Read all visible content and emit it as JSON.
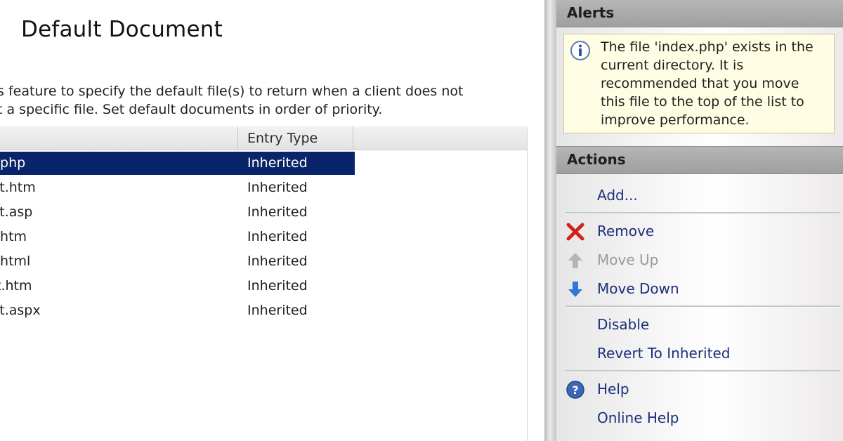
{
  "main": {
    "title": "Default Document",
    "description": [
      "s feature to specify the default file(s) to return when a client does not",
      "t a specific file. Set default documents in order of priority."
    ],
    "list": {
      "columns": [
        "",
        "Entry Type"
      ],
      "rows": [
        {
          "name": ".php",
          "type": "Inherited"
        },
        {
          "name": "lt.htm",
          "type": "Inherited"
        },
        {
          "name": "lt.asp",
          "type": "Inherited"
        },
        {
          "name": ".htm",
          "type": "Inherited"
        },
        {
          "name": ".html",
          "type": "Inherited"
        },
        {
          "name": "t.htm",
          "type": "Inherited"
        },
        {
          "name": "lt.aspx",
          "type": "Inherited"
        }
      ]
    }
  },
  "alerts": {
    "title": "Alerts",
    "icon": "info-icon",
    "lines": [
      "The file 'index.php' exists in the",
      "current directory. It is",
      "recommended that you move",
      "this file to the top of the list to",
      "improve performance."
    ]
  },
  "actions": {
    "title": "Actions",
    "add": "Add...",
    "remove": "Remove",
    "move_up": "Move Up",
    "move_down": "Move Down",
    "disable": "Disable",
    "revert": "Revert To Inherited",
    "help": "Help",
    "online_help": "Online Help"
  },
  "colors": {
    "selection": "#0a246a",
    "link": "#1b2f7a",
    "alert_bg": "#fffde3",
    "remove_icon": "#d4201b",
    "arrow_icon": "#2e78d8"
  }
}
